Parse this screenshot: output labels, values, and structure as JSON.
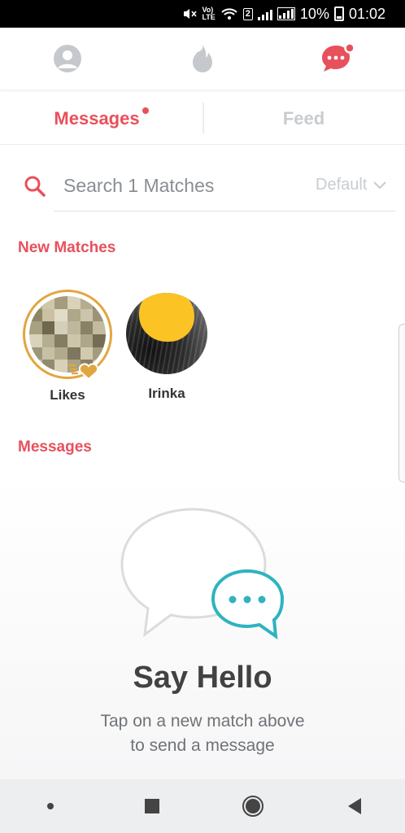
{
  "status_bar": {
    "volte": "VoLTE",
    "sim_badge": "2",
    "battery": "10%",
    "time": "01:02"
  },
  "top_nav": {
    "items": [
      "profile-icon",
      "flame-icon",
      "chat-icon"
    ],
    "active": "chat-icon",
    "accent_color": "#e8505b",
    "inactive_color": "#c5c9cd"
  },
  "tabs": {
    "messages": "Messages",
    "feed": "Feed",
    "active": "messages"
  },
  "search": {
    "placeholder": "Search 1 Matches",
    "sort_value": "Default"
  },
  "new_matches": {
    "title": "New Matches",
    "items": [
      {
        "label": "Likes",
        "ring_color": "#e2a63f"
      },
      {
        "label": "Irinka"
      }
    ]
  },
  "messages_section": {
    "title": "Messages"
  },
  "empty_state": {
    "title": "Say Hello",
    "line1": "Tap on a new match above",
    "line2": "to send a message",
    "bubble_accent": "#2fb3c0"
  },
  "system_nav": {
    "items": [
      "dot-icon",
      "recents-icon",
      "home-icon",
      "back-icon"
    ]
  }
}
